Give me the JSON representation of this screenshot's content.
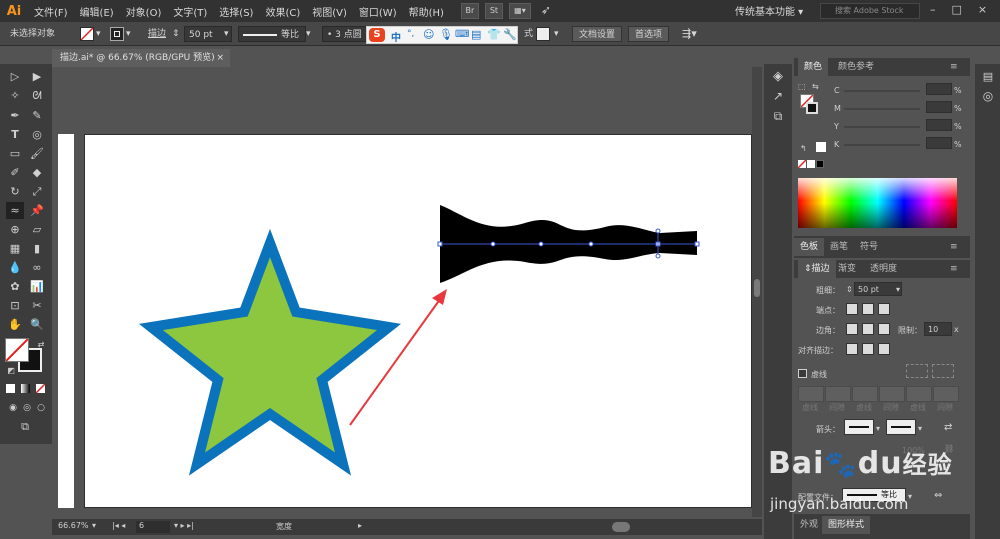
{
  "app": {
    "logo": "Ai"
  },
  "menus": [
    "文件(F)",
    "编辑(E)",
    "对象(O)",
    "文字(T)",
    "选择(S)",
    "效果(C)",
    "视图(V)",
    "窗口(W)",
    "帮助(H)"
  ],
  "menu_buttons": [
    "Br",
    "St"
  ],
  "workspace": "传统基本功能",
  "search": {
    "placeholder": "搜索 Adobe Stock"
  },
  "control_bar": {
    "selection_status": "未选择对象",
    "stroke_label": "描边",
    "stroke_weight": "50 pt",
    "profile": "等比",
    "brush": "3 点圆",
    "style_label": "式",
    "document_setup": "文档设置",
    "preferences": "首选项",
    "ime_chars": [
      "中",
      "°,"
    ]
  },
  "document_tab": {
    "title": "描边.ai* @ 66.67% (RGB/GPU 预览)",
    "close": "×"
  },
  "status_bar": {
    "zoom": "66.67%",
    "artboard": "6",
    "tool": "宽度"
  },
  "color_panel": {
    "tabs": [
      "颜色",
      "颜色参考"
    ],
    "channels": [
      "C",
      "M",
      "Y",
      "K"
    ],
    "percent": "%"
  },
  "swatch_tabs": [
    "色板",
    "画笔",
    "符号"
  ],
  "stroke_panel": {
    "tabs": [
      "描边",
      "渐变",
      "透明度"
    ],
    "weight_label": "粗细：",
    "weight_value": "50 pt",
    "cap_label": "端点：",
    "corner_label": "边角：",
    "limit_label": "限制：",
    "limit_value": "10",
    "limit_unit": "x",
    "align_label": "对齐描边：",
    "dashed_label": "虚线",
    "dash_labels": [
      "虚线",
      "间隙",
      "虚线",
      "间隙",
      "虚线",
      "间隙"
    ],
    "arrow_label": "箭头：",
    "scale_value": "100%",
    "profile_label": "配置文件：",
    "profile_value": "等比"
  },
  "bottom_tabs": [
    "外观",
    "图形样式"
  ],
  "watermark": {
    "brand": "Bai",
    "paw": "du",
    "cn": "经验",
    "url": "jingyan.baidu.com"
  },
  "colors": {
    "star_fill": "#8dc63f",
    "star_stroke": "#0b73bb",
    "arrow": "#e8383d",
    "path_selection": "#3a59d6",
    "ai_orange": "#f7941d"
  }
}
